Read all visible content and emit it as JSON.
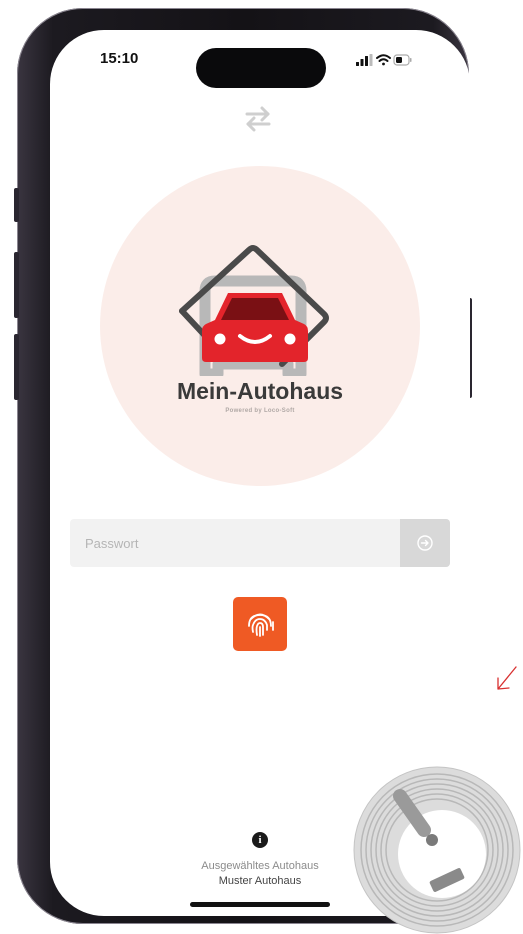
{
  "status_bar": {
    "time": "15:10"
  },
  "logo": {
    "name": "Mein-Autohaus",
    "tagline": "Powered by Loco-Soft"
  },
  "password": {
    "placeholder": "Passwort",
    "value": ""
  },
  "footer": {
    "selected_label": "Ausgewähltes Autohaus",
    "selected_value": "Muster Autohaus"
  },
  "icons": {
    "switch": "swap-arrows-icon",
    "submit": "arrow-right-circle-icon",
    "biometric": "fingerprint-icon",
    "info": "info-icon"
  },
  "colors": {
    "accent": "#ef5a24",
    "car_red": "#e3242b",
    "logo_background": "#fbede9",
    "input_background": "#f2f2f2"
  }
}
